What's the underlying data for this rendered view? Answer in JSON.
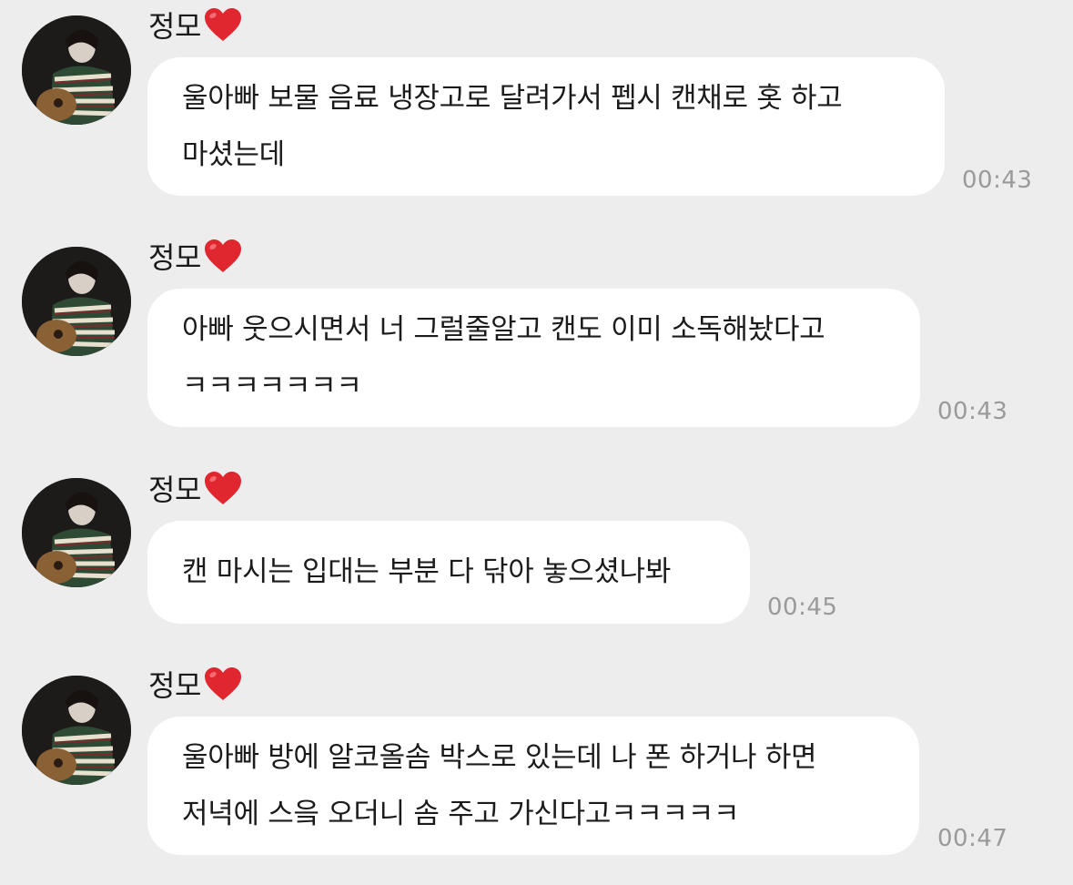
{
  "chat": {
    "messages": [
      {
        "sender": "정모",
        "lines": [
          "울아빠 보물 음료 냉장고로 달려가서 펩시 캔채로 홋 하고",
          "마셨는데"
        ],
        "time": "00:43"
      },
      {
        "sender": "정모",
        "lines": [
          "아빠 웃으시면서 너 그럴줄알고 캔도 이미 소독해놨다고",
          "ㅋㅋㅋㅋㅋㅋㅋ"
        ],
        "time": "00:43"
      },
      {
        "sender": "정모",
        "lines": [
          "캔 마시는 입대는 부분 다 닦아 놓으셨나봐"
        ],
        "time": "00:45"
      },
      {
        "sender": "정모",
        "lines": [
          "울아빠 방에 알코올솜 박스로 있는데 나 폰 하거나 하면",
          "저녁에 스읔 오더니 솜 주고 가신다고ㅋㅋㅋㅋㅋ"
        ],
        "time": "00:47"
      }
    ]
  },
  "icons": {
    "heart": "red-heart-icon",
    "avatar": "profile-photo"
  },
  "colors": {
    "background": "#ededed",
    "bubble": "#ffffff",
    "heart": "#e0262f",
    "time": "#9a9a9a"
  }
}
